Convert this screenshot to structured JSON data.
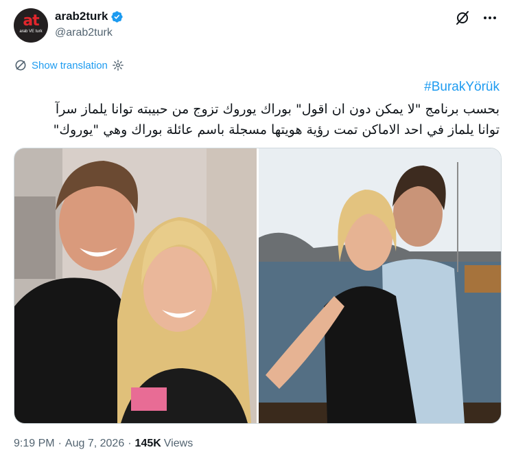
{
  "account": {
    "display_name": "arab2turk",
    "handle": "@arab2turk",
    "verified": true,
    "avatar_text": "at",
    "avatar_subtext": "arab VE turk"
  },
  "translate": {
    "label": "Show translation"
  },
  "tweet": {
    "hashtag": "#BurakYörük",
    "line1": "بحسب برنامج \"لا يمكن دون ان اقول\" بوراك يوروك تزوج من حبيبته توانا يلماز سرآ",
    "line2": "توانا يلماز في احد الاماكن تمت رؤية هويتها مسجلة باسم عائلة بوراك وهي \"يوروك\""
  },
  "photos": [
    {
      "subject": "couple-selfie"
    },
    {
      "subject": "couple-on-boat"
    }
  ],
  "meta": {
    "time": "9:19 PM",
    "date": "Aug 7, 2026",
    "views_count": "145K",
    "views_label": "Views"
  },
  "icons": {
    "verified": "verified-badge-icon",
    "grok": "grok-icon",
    "more": "more-icon",
    "translate": "globe-icon",
    "settings": "gear-icon"
  },
  "colors": {
    "accent": "#1d9bf0",
    "text": "#0f1419",
    "secondary": "#536471",
    "border": "#cfd9de"
  }
}
